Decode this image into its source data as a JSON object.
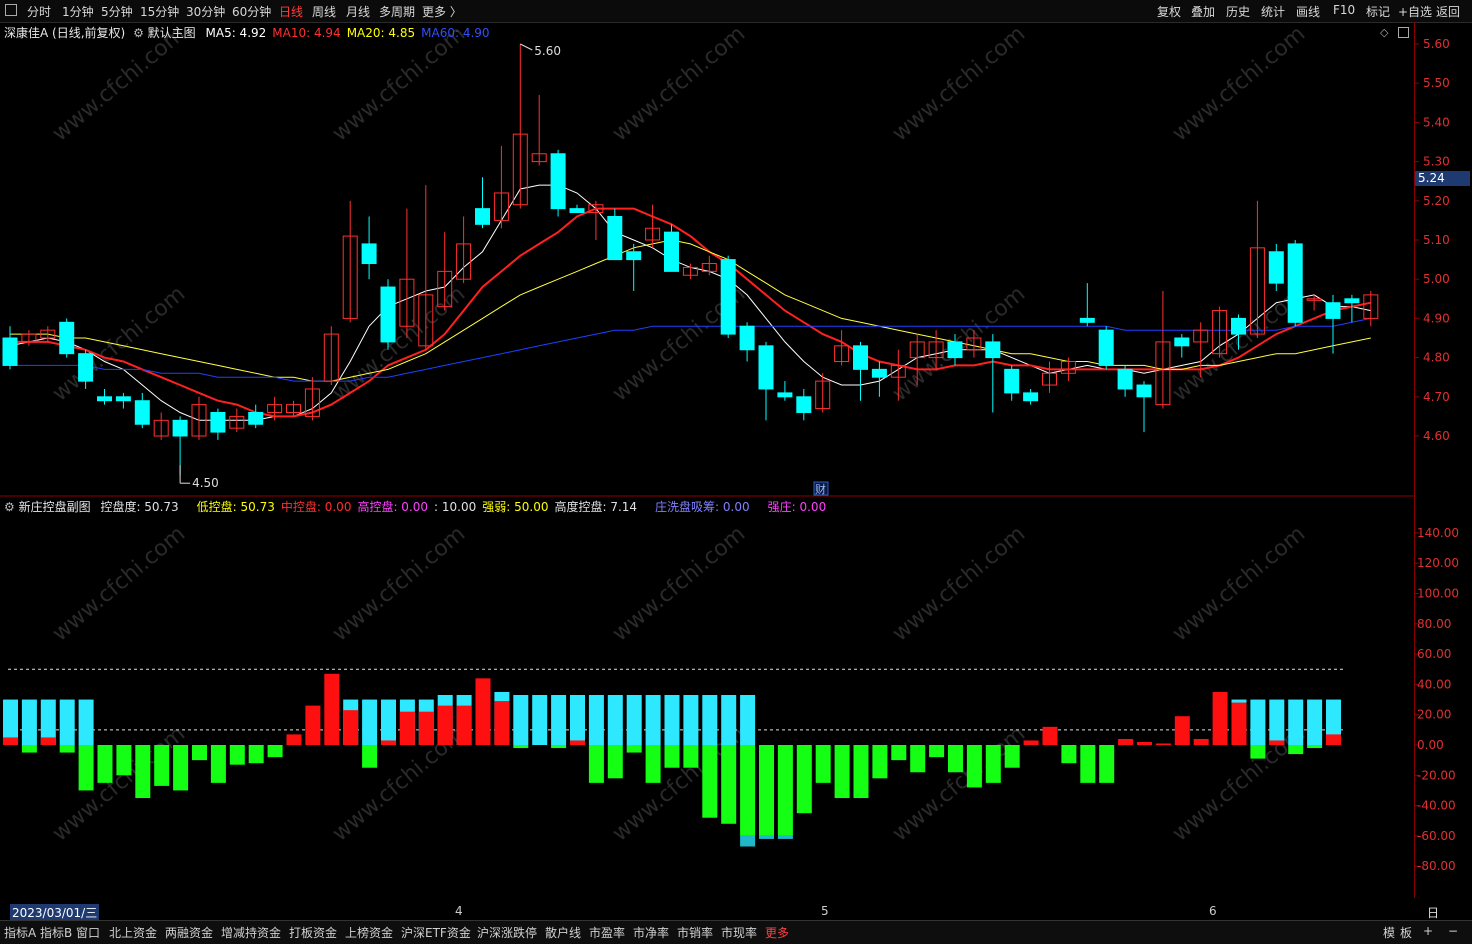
{
  "toolbar": {
    "periods": [
      "分时",
      "1分钟",
      "5分钟",
      "15分钟",
      "30分钟",
      "60分钟",
      "日线",
      "周线",
      "月线",
      "多周期",
      "更多 〉"
    ],
    "active_period": "日线",
    "tools": [
      "复权",
      "叠加",
      "历史",
      "统计",
      "画线",
      "F10",
      "标记",
      "+自选",
      "返回"
    ]
  },
  "main_chart": {
    "stock": "深康佳A",
    "mode": "(日线,前复权)",
    "indicator_name": "默认主图",
    "ma": [
      {
        "label": "MA5: 4.92",
        "color": "#ffffff"
      },
      {
        "label": "MA10: 4.94",
        "color": "#ff3030"
      },
      {
        "label": "MA20: 4.85",
        "color": "#ffff00"
      },
      {
        "label": "MA60: 4.90",
        "color": "#3050ff"
      }
    ],
    "high_marker": "5.60",
    "low_marker": "4.50",
    "current_price": "5.24",
    "finance_marker": "财",
    "y_ticks": [
      "5.60",
      "5.50",
      "5.40",
      "5.30",
      "5.20",
      "5.10",
      "5.00",
      "4.90",
      "4.80",
      "4.70",
      "4.60"
    ]
  },
  "sub_chart": {
    "indicator_name": "新庄控盘副图",
    "fields": [
      {
        "label": "控盘度: 50.73",
        "color": "#e0e0e0"
      },
      {
        "label": "低控盘: 50.73",
        "color": "#ffff00"
      },
      {
        "label": "中控盘: 0.00",
        "color": "#ff3030"
      },
      {
        "label": "高控盘: 0.00",
        "color": "#ff40ff"
      },
      {
        "label": ": 10.00",
        "color": "#e0e0e0"
      },
      {
        "label": "强弱: 50.00",
        "color": "#ffff00"
      },
      {
        "label": "高度控盘: 7.14",
        "color": "#e0e0e0"
      },
      {
        "label": "庄洗盘吸筹: 0.00",
        "color": "#8080ff"
      },
      {
        "label": "强庄: 0.00",
        "color": "#ff40ff"
      }
    ],
    "y_ticks": [
      "140.00",
      "120.00",
      "100.00",
      "80.00",
      "60.00",
      "40.00",
      "20.00",
      "0.00",
      "-20.00",
      "-40.00",
      "-60.00",
      "-80.00"
    ]
  },
  "chart_data": {
    "type": "candlestick",
    "title": "深康佳A (日线,前复权)",
    "ylim": [
      4.5,
      5.65
    ],
    "candles": [
      [
        4.85,
        4.78,
        4.88,
        4.77
      ],
      [
        4.84,
        4.86,
        4.87,
        4.83
      ],
      [
        4.85,
        4.87,
        4.88,
        4.84
      ],
      [
        4.89,
        4.81,
        4.9,
        4.8
      ],
      [
        4.81,
        4.74,
        4.82,
        4.72
      ],
      [
        4.7,
        4.69,
        4.72,
        4.68
      ],
      [
        4.7,
        4.69,
        4.71,
        4.67
      ],
      [
        4.69,
        4.63,
        4.71,
        4.62
      ],
      [
        4.6,
        4.64,
        4.66,
        4.59
      ],
      [
        4.64,
        4.6,
        4.65,
        4.5
      ],
      [
        4.6,
        4.68,
        4.7,
        4.59
      ],
      [
        4.66,
        4.61,
        4.67,
        4.59
      ],
      [
        4.62,
        4.65,
        4.67,
        4.61
      ],
      [
        4.66,
        4.63,
        4.68,
        4.62
      ],
      [
        4.66,
        4.68,
        4.7,
        4.64
      ],
      [
        4.66,
        4.68,
        4.69,
        4.65
      ],
      [
        4.65,
        4.72,
        4.75,
        4.64
      ],
      [
        4.74,
        4.86,
        4.88,
        4.73
      ],
      [
        4.9,
        5.11,
        5.2,
        4.89
      ],
      [
        5.09,
        5.04,
        5.16,
        5.0
      ],
      [
        4.98,
        4.84,
        5.0,
        4.82
      ],
      [
        4.88,
        5.0,
        5.18,
        4.85
      ],
      [
        4.83,
        4.96,
        5.24,
        4.82
      ],
      [
        4.93,
        5.02,
        5.12,
        4.92
      ],
      [
        5.0,
        5.09,
        5.16,
        4.99
      ],
      [
        5.18,
        5.14,
        5.26,
        5.13
      ],
      [
        5.15,
        5.22,
        5.34,
        5.13
      ],
      [
        5.19,
        5.37,
        5.6,
        5.18
      ],
      [
        5.3,
        5.32,
        5.47,
        5.29
      ],
      [
        5.32,
        5.18,
        5.33,
        5.16
      ],
      [
        5.18,
        5.17,
        5.19,
        5.17
      ],
      [
        5.17,
        5.19,
        5.2,
        5.1
      ],
      [
        5.16,
        5.05,
        5.18,
        5.05
      ],
      [
        5.07,
        5.05,
        5.09,
        4.97
      ],
      [
        5.1,
        5.13,
        5.19,
        5.08
      ],
      [
        5.12,
        5.02,
        5.14,
        5.02
      ],
      [
        5.01,
        5.03,
        5.04,
        5.0
      ],
      [
        5.02,
        5.04,
        5.06,
        5.01
      ],
      [
        5.05,
        4.86,
        5.06,
        4.85
      ],
      [
        4.88,
        4.82,
        4.89,
        4.79
      ],
      [
        4.83,
        4.72,
        4.84,
        4.64
      ],
      [
        4.71,
        4.7,
        4.74,
        4.69
      ],
      [
        4.7,
        4.66,
        4.72,
        4.64
      ],
      [
        4.67,
        4.74,
        4.76,
        4.66
      ],
      [
        4.79,
        4.83,
        4.87,
        4.78
      ],
      [
        4.83,
        4.77,
        4.84,
        4.69
      ],
      [
        4.77,
        4.75,
        4.79,
        4.7
      ],
      [
        4.75,
        4.78,
        4.82,
        4.69
      ],
      [
        4.8,
        4.84,
        4.86,
        4.73
      ],
      [
        4.8,
        4.84,
        4.87,
        4.77
      ],
      [
        4.84,
        4.8,
        4.86,
        4.78
      ],
      [
        4.82,
        4.85,
        4.87,
        4.8
      ],
      [
        4.84,
        4.8,
        4.86,
        4.66
      ],
      [
        4.77,
        4.71,
        4.78,
        4.69
      ],
      [
        4.71,
        4.69,
        4.72,
        4.68
      ],
      [
        4.73,
        4.76,
        4.79,
        4.71
      ],
      [
        4.76,
        4.79,
        4.8,
        4.74
      ],
      [
        4.9,
        4.89,
        4.99,
        4.88
      ],
      [
        4.87,
        4.78,
        4.88,
        4.77
      ],
      [
        4.77,
        4.72,
        4.78,
        4.7
      ],
      [
        4.73,
        4.7,
        4.74,
        4.61
      ],
      [
        4.68,
        4.84,
        4.97,
        4.67
      ],
      [
        4.85,
        4.83,
        4.86,
        4.8
      ],
      [
        4.84,
        4.87,
        4.89,
        4.75
      ],
      [
        4.81,
        4.92,
        4.93,
        4.8
      ],
      [
        4.9,
        4.86,
        4.91,
        4.82
      ],
      [
        4.86,
        5.08,
        5.2,
        4.85
      ],
      [
        5.07,
        4.99,
        5.09,
        4.97
      ],
      [
        5.09,
        4.89,
        5.1,
        4.88
      ],
      [
        4.95,
        4.95,
        4.96,
        4.92
      ],
      [
        4.94,
        4.9,
        4.96,
        4.81
      ],
      [
        4.95,
        4.94,
        4.96,
        4.89
      ],
      [
        4.9,
        4.96,
        4.97,
        4.88
      ]
    ],
    "ma_series": [
      {
        "name": "MA5",
        "color": "#ffffff",
        "values": [
          4.83,
          4.84,
          4.85,
          4.84,
          4.82,
          4.79,
          4.77,
          4.73,
          4.69,
          4.66,
          4.64,
          4.64,
          4.64,
          4.64,
          4.65,
          4.65,
          4.67,
          4.71,
          4.79,
          4.88,
          4.93,
          4.95,
          4.97,
          4.98,
          5.03,
          5.07,
          5.15,
          5.23,
          5.24,
          5.24,
          5.22,
          5.18,
          5.12,
          5.1,
          5.08,
          5.05,
          5.03,
          5.02,
          5.0,
          4.96,
          4.9,
          4.84,
          4.79,
          4.75,
          4.73,
          4.73,
          4.74,
          4.77,
          4.8,
          4.81,
          4.82,
          4.82,
          4.82,
          4.8,
          4.78,
          4.76,
          4.77,
          4.78,
          4.77,
          4.77,
          4.76,
          4.77,
          4.78,
          4.79,
          4.83,
          4.86,
          4.9,
          4.94,
          4.95,
          4.96,
          4.93,
          4.93,
          4.92
        ]
      },
      {
        "name": "MA10",
        "color": "#ff2020",
        "values": [
          4.84,
          4.84,
          4.84,
          4.83,
          4.82,
          4.8,
          4.79,
          4.77,
          4.75,
          4.73,
          4.71,
          4.69,
          4.68,
          4.66,
          4.65,
          4.65,
          4.66,
          4.68,
          4.71,
          4.74,
          4.78,
          4.8,
          4.82,
          4.86,
          4.92,
          4.98,
          5.02,
          5.06,
          5.09,
          5.12,
          5.16,
          5.18,
          5.18,
          5.18,
          5.16,
          5.14,
          5.11,
          5.07,
          5.04,
          5.0,
          4.96,
          4.92,
          4.89,
          4.86,
          4.84,
          4.81,
          4.79,
          4.78,
          4.77,
          4.77,
          4.78,
          4.78,
          4.79,
          4.78,
          4.78,
          4.77,
          4.77,
          4.77,
          4.77,
          4.77,
          4.77,
          4.77,
          4.77,
          4.77,
          4.78,
          4.8,
          4.83,
          4.86,
          4.88,
          4.9,
          4.92,
          4.93,
          4.94
        ]
      },
      {
        "name": "MA20",
        "color": "#ffff40",
        "values": [
          4.86,
          4.86,
          4.86,
          4.85,
          4.85,
          4.84,
          4.83,
          4.82,
          4.81,
          4.8,
          4.79,
          4.78,
          4.77,
          4.76,
          4.75,
          4.75,
          4.74,
          4.74,
          4.75,
          4.76,
          4.77,
          4.79,
          4.81,
          4.84,
          4.87,
          4.9,
          4.93,
          4.96,
          4.98,
          5.0,
          5.02,
          5.04,
          5.06,
          5.08,
          5.09,
          5.1,
          5.09,
          5.07,
          5.05,
          5.02,
          4.99,
          4.96,
          4.94,
          4.92,
          4.9,
          4.89,
          4.88,
          4.87,
          4.86,
          4.85,
          4.84,
          4.83,
          4.82,
          4.81,
          4.81,
          4.8,
          4.79,
          4.79,
          4.78,
          4.78,
          4.78,
          4.77,
          4.77,
          4.78,
          4.78,
          4.79,
          4.8,
          4.81,
          4.81,
          4.82,
          4.83,
          4.84,
          4.85
        ]
      },
      {
        "name": "MA60",
        "color": "#2040ff",
        "values": [
          4.78,
          4.78,
          4.78,
          4.78,
          4.78,
          4.77,
          4.77,
          4.77,
          4.76,
          4.76,
          4.76,
          4.75,
          4.75,
          4.75,
          4.75,
          4.74,
          4.74,
          4.74,
          4.74,
          4.75,
          4.75,
          4.76,
          4.77,
          4.78,
          4.79,
          4.8,
          4.81,
          4.82,
          4.83,
          4.84,
          4.85,
          4.86,
          4.87,
          4.87,
          4.88,
          4.88,
          4.88,
          4.88,
          4.88,
          4.88,
          4.88,
          4.88,
          4.88,
          4.88,
          4.88,
          4.88,
          4.88,
          4.88,
          4.88,
          4.88,
          4.88,
          4.88,
          4.88,
          4.88,
          4.88,
          4.88,
          4.88,
          4.88,
          4.88,
          4.87,
          4.87,
          4.87,
          4.87,
          4.87,
          4.87,
          4.87,
          4.87,
          4.87,
          4.88,
          4.88,
          4.88,
          4.89,
          4.9
        ]
      }
    ],
    "sub_chart": {
      "ylim": [
        -90,
        150
      ],
      "dashed_lines": [
        50,
        10
      ],
      "bars": [
        [
          30,
          5
        ],
        [
          30,
          -5
        ],
        [
          30,
          5
        ],
        [
          30,
          -5
        ],
        [
          30,
          -30
        ],
        [
          0,
          -25
        ],
        [
          0,
          -20
        ],
        [
          0,
          -35
        ],
        [
          0,
          -27
        ],
        [
          0,
          -30
        ],
        [
          0,
          -10
        ],
        [
          0,
          -25
        ],
        [
          0,
          -13
        ],
        [
          0,
          -12
        ],
        [
          0,
          -8
        ],
        [
          0,
          7
        ],
        [
          0,
          26
        ],
        [
          0,
          47
        ],
        [
          30,
          23
        ],
        [
          30,
          -15
        ],
        [
          30,
          3
        ],
        [
          30,
          22
        ],
        [
          30,
          22
        ],
        [
          33,
          26
        ],
        [
          33,
          26
        ],
        [
          30,
          44
        ],
        [
          35,
          29
        ],
        [
          33,
          -2
        ],
        [
          33,
          0
        ],
        [
          33,
          -2
        ],
        [
          33,
          3
        ],
        [
          33,
          -25
        ],
        [
          33,
          -22
        ],
        [
          33,
          -5
        ],
        [
          33,
          -25
        ],
        [
          33,
          -15
        ],
        [
          33,
          -15
        ],
        [
          33,
          -48
        ],
        [
          33,
          -52
        ],
        [
          33,
          -67
        ],
        [
          0,
          -62
        ],
        [
          0,
          -62
        ],
        [
          0,
          -45
        ],
        [
          0,
          -25
        ],
        [
          0,
          -35
        ],
        [
          0,
          -35
        ],
        [
          0,
          -22
        ],
        [
          0,
          -10
        ],
        [
          0,
          -18
        ],
        [
          0,
          -8
        ],
        [
          0,
          -18
        ],
        [
          0,
          -28
        ],
        [
          0,
          -25
        ],
        [
          0,
          -15
        ],
        [
          0,
          3
        ],
        [
          0,
          12
        ],
        [
          0,
          -12
        ],
        [
          0,
          -25
        ],
        [
          0,
          -25
        ],
        [
          0,
          4
        ],
        [
          0,
          2
        ],
        [
          0,
          1
        ],
        [
          0,
          19
        ],
        [
          0,
          4
        ],
        [
          0,
          35
        ],
        [
          30,
          28
        ],
        [
          30,
          -9
        ],
        [
          30,
          3
        ],
        [
          30,
          -6
        ],
        [
          30,
          -2
        ],
        [
          30,
          7
        ]
      ]
    },
    "x_labels": [
      "2023/03/01/三",
      "4",
      "5",
      "6"
    ],
    "x_period_label": "日线"
  },
  "bottom_tabs": [
    "指标A",
    "指标B",
    "窗口",
    "北上资金",
    "两融资金",
    "增减持资金",
    "打板资金",
    "上榜资金",
    "沪深ETF资金",
    "沪深涨跌停",
    "散户线",
    "市盈率",
    "市净率",
    "市销率",
    "市现率",
    "更多"
  ],
  "bottom_right": [
    "模",
    "板",
    "+",
    "−"
  ],
  "watermark": "www.cfchi.com"
}
